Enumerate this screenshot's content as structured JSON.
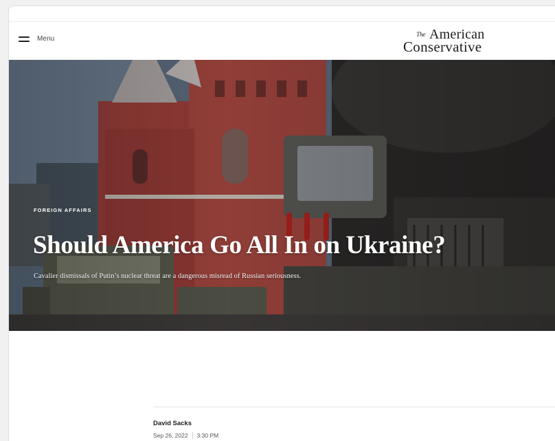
{
  "header": {
    "menu_label": "Menu",
    "logo": {
      "the": "The",
      "american": "American",
      "conservative": "Conservative"
    }
  },
  "hero": {
    "category": "FOREIGN AFFAIRS",
    "title": "Should America Go All In on Ukraine?",
    "dek": "Cavalier dismissals of Putin’s nuclear threat are a dangerous misread of Russian seriousness."
  },
  "byline": {
    "author": "David Sacks",
    "date": "Sep 26, 2022",
    "time": "3:30 PM"
  }
}
